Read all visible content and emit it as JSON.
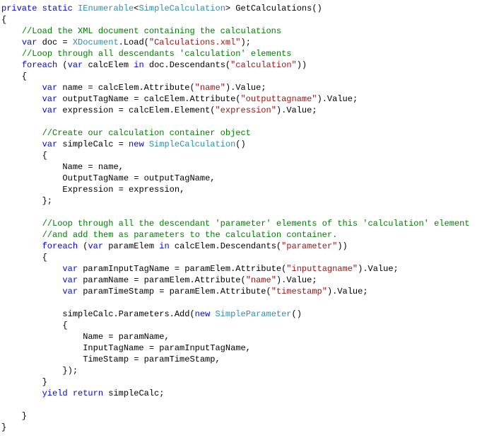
{
  "code": {
    "language": "csharp",
    "colors": {
      "keyword": "#0000ff",
      "type": "#2b91af",
      "string": "#a31515",
      "comment": "#008000",
      "default": "#000000"
    },
    "tokens": {
      "kw": [
        "private",
        "static",
        "var",
        "foreach",
        "in",
        "new",
        "yield",
        "return"
      ],
      "typ": [
        "IEnumerable",
        "SimpleCalculation",
        "XDocument",
        "SimpleParameter"
      ],
      "str_xml": "\"Calculations.xml\"",
      "str_calculation": "\"calculation\"",
      "str_name": "\"name\"",
      "str_outputtagname": "\"outputtagname\"",
      "str_expression": "\"expression\"",
      "str_parameter": "\"parameter\"",
      "str_inputtagname": "\"inputtagname\"",
      "str_timestamp": "\"timestamp\"",
      "cmt_load": "//Load the XML document containing the calculations",
      "cmt_loop1": "//Loop through all descendants 'calculation' elements",
      "cmt_create": "//Create our calculation container object",
      "cmt_loop2a": "//Loop through all the descendant 'parameter' elements of this 'calculation' element",
      "cmt_loop2b": "//and add them as parameters to the calculation container.",
      "ident": {
        "GetCalculations": "GetCalculations",
        "doc": "doc",
        "Load": "Load",
        "calcElem": "calcElem",
        "Descendants": "Descendants",
        "name": "name",
        "Attribute": "Attribute",
        "Value": "Value",
        "outputTagName": "outputTagName",
        "expression": "expression",
        "Element": "Element",
        "simpleCalc": "simpleCalc",
        "Name": "Name",
        "OutputTagName": "OutputTagName",
        "Expression": "Expression",
        "paramElem": "paramElem",
        "paramInputTagName": "paramInputTagName",
        "paramName": "paramName",
        "paramTimeStamp": "paramTimeStamp",
        "Parameters": "Parameters",
        "Add": "Add",
        "InputTagName": "InputTagName",
        "TimeStamp": "TimeStamp"
      }
    }
  }
}
